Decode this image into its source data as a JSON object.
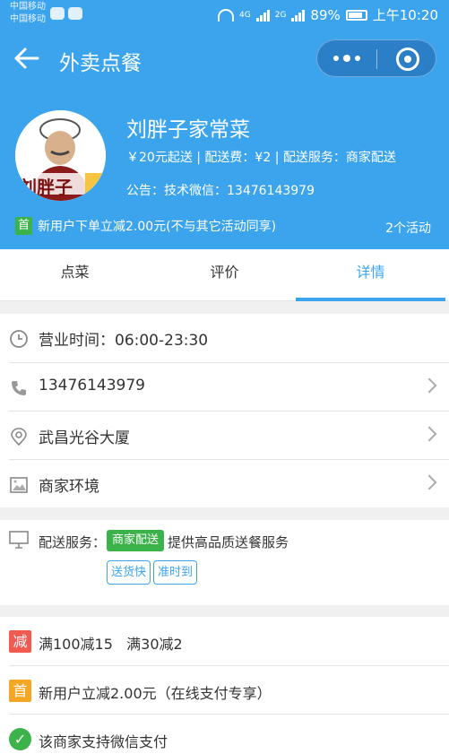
{
  "status_bar": {
    "carrier_1": "中国移动",
    "carrier_2": "中国移动",
    "network_4g": "4G",
    "network_2g": "2G",
    "battery": "89%",
    "time": "上午10:20"
  },
  "nav": {
    "title": "外卖点餐"
  },
  "shop": {
    "name": "刘胖子家常菜",
    "logo_text": "刘胖子",
    "info": "￥20元起送 | 配送费：¥2 | 配送服务：商家配送",
    "notice": "公告：技术微信：13476143979",
    "promo_badge": "首",
    "promo_text": "新用户下单立减2.00元(不与其它活动同享)",
    "activity_count": "2个活动"
  },
  "tabs": [
    {
      "label": "点菜",
      "active": false
    },
    {
      "label": "评价",
      "active": false
    },
    {
      "label": "详情",
      "active": true
    }
  ],
  "details": {
    "hours": "营业时间：06:00-23:30",
    "phone": "13476143979",
    "address": "武昌光谷大厦",
    "environment": "商家环境"
  },
  "delivery": {
    "label": "配送服务：",
    "tag": "商家配送",
    "desc": "提供高品质送餐服务",
    "features": [
      "送货快",
      "准时到"
    ]
  },
  "activities": [
    {
      "badge": "减",
      "text": "满100减15   满30减2",
      "color": "#f05a4f"
    },
    {
      "badge": "首",
      "text": "新用户立减2.00元（在线支付专享）",
      "color": "#f5a623"
    },
    {
      "badge": "✓",
      "text": "该商家支持微信支付",
      "color": "#3cb34a"
    }
  ],
  "colors": {
    "accent": "#3ba4ec",
    "green": "#3cb34a",
    "red": "#f05a4f",
    "orange": "#f5a623"
  }
}
